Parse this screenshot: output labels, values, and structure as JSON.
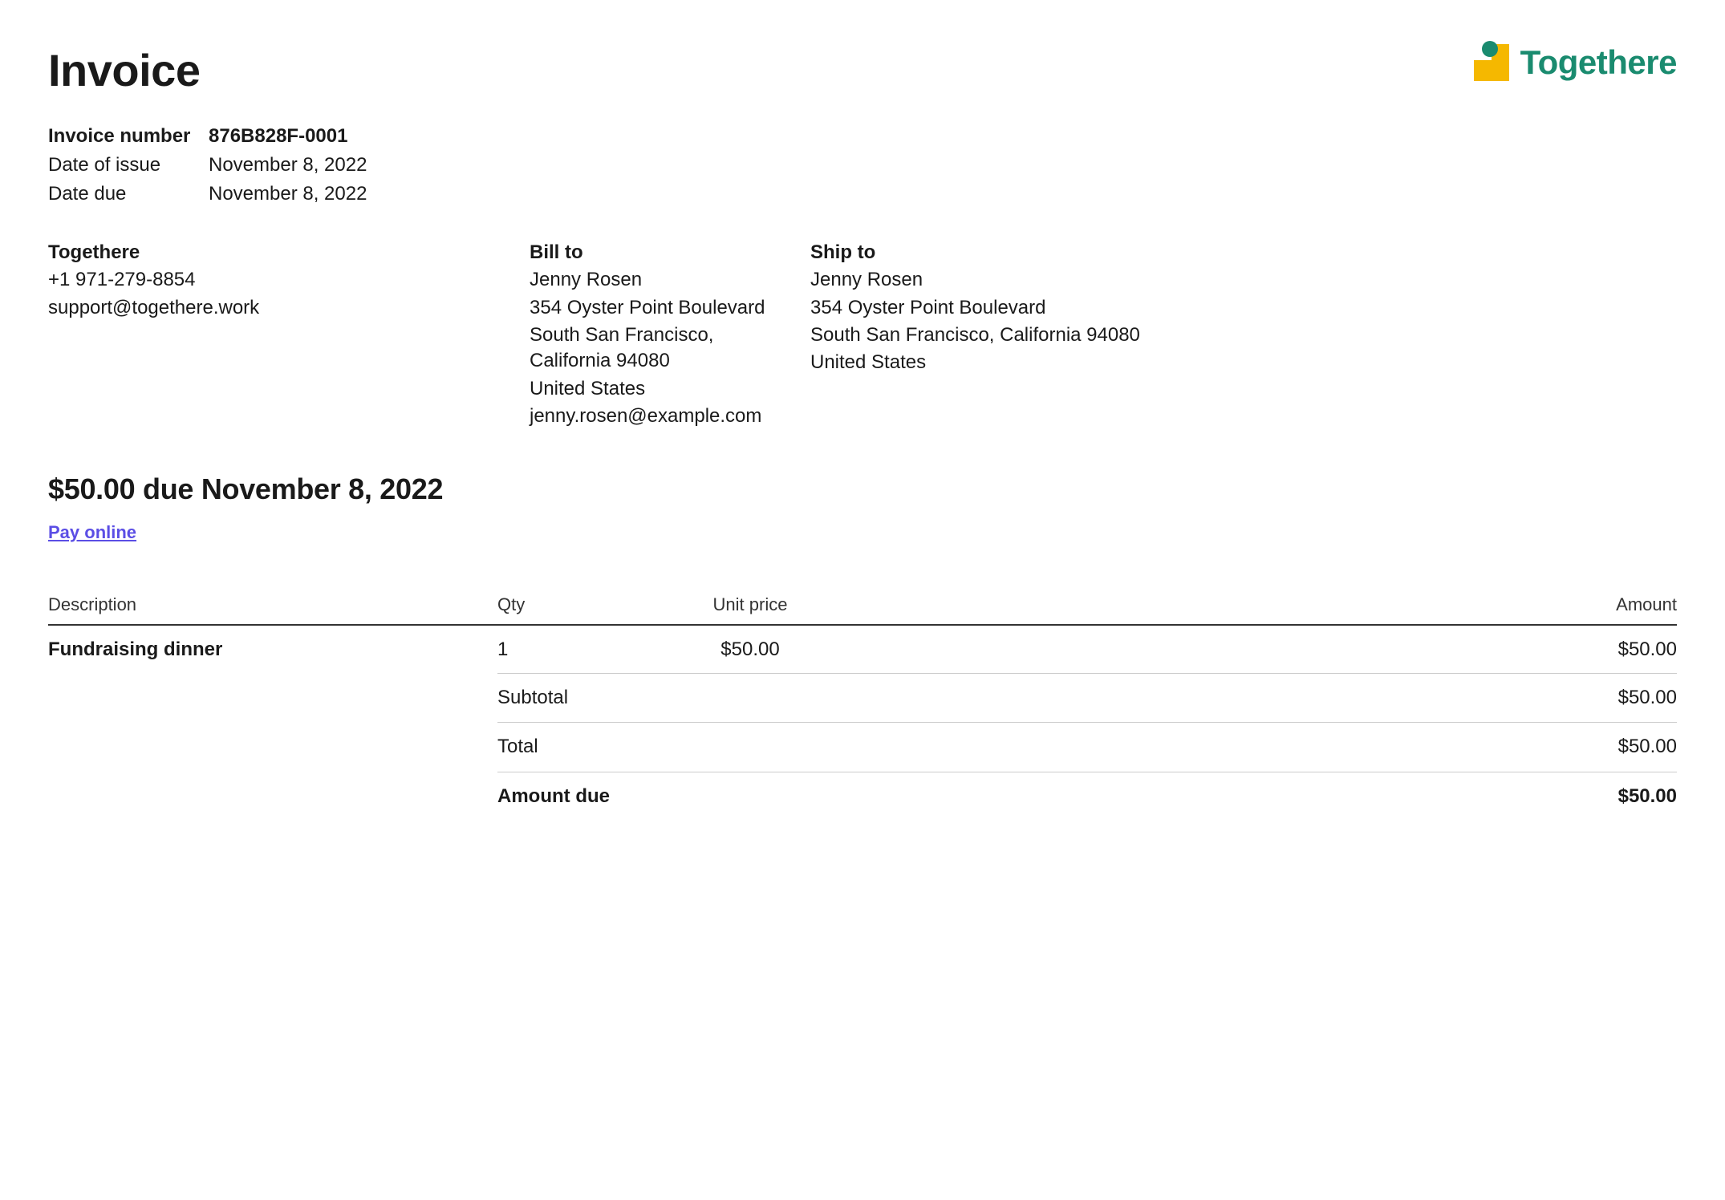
{
  "title": "Invoice",
  "brand": {
    "name": "Togethere"
  },
  "meta": {
    "invoice_number_label": "Invoice number",
    "invoice_number_value": "876B828F-0001",
    "date_of_issue_label": "Date of issue",
    "date_of_issue_value": "November 8, 2022",
    "date_due_label": "Date due",
    "date_due_value": "November 8, 2022"
  },
  "from": {
    "name": "Togethere",
    "phone": "+1 971-279-8854",
    "email": "support@togethere.work"
  },
  "bill_to": {
    "heading": "Bill to",
    "name": "Jenny Rosen",
    "street": "354 Oyster Point Boulevard",
    "city_state_zip": "South San Francisco, California 94080",
    "country": "United States",
    "email": "jenny.rosen@example.com"
  },
  "ship_to": {
    "heading": "Ship to",
    "name": "Jenny Rosen",
    "street": "354 Oyster Point Boulevard",
    "city_state_zip": "South San Francisco, California 94080",
    "country": "United States"
  },
  "due_summary": "$50.00 due November 8, 2022",
  "pay_online_label": "Pay online",
  "columns": {
    "description": "Description",
    "qty": "Qty",
    "unit_price": "Unit price",
    "amount": "Amount"
  },
  "line_items": [
    {
      "description": "Fundraising dinner",
      "qty": "1",
      "unit_price": "$50.00",
      "amount": "$50.00"
    }
  ],
  "totals": {
    "subtotal_label": "Subtotal",
    "subtotal_value": "$50.00",
    "total_label": "Total",
    "total_value": "$50.00",
    "amount_due_label": "Amount due",
    "amount_due_value": "$50.00"
  }
}
